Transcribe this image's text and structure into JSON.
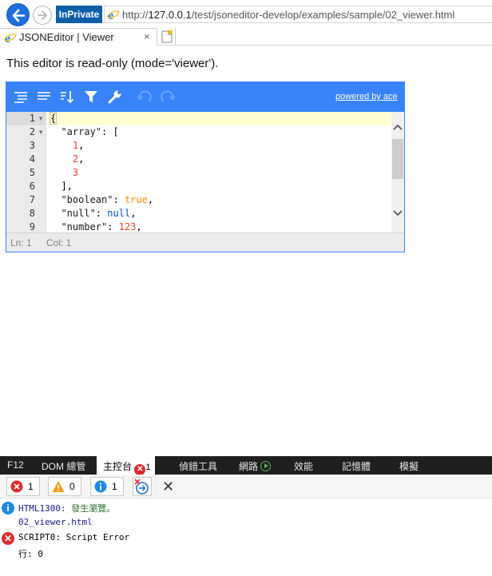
{
  "browser": {
    "inprivate_label": "InPrivate",
    "url_prefix": "http://",
    "url_host": "127.0.0.1",
    "url_path": "/test/jsoneditor-develop/examples/sample/02_viewer.html",
    "tab_title": "JSONEditor | Viewer",
    "tab_close": "×"
  },
  "page": {
    "intro_text": "This editor is read-only (mode='viewer')."
  },
  "editor": {
    "powered_by": "powered by ace",
    "toolbar": [
      "expand-all-icon",
      "collapse-all-icon",
      "sort-icon",
      "filter-icon",
      "transform-icon",
      "undo-icon",
      "redo-icon"
    ],
    "line_numbers": [
      "1",
      "2",
      "3",
      "4",
      "5",
      "6",
      "7",
      "8",
      "9"
    ],
    "lines": [
      "{",
      "  \"array\": [",
      "    1,",
      "    2,",
      "    3",
      "  ],",
      "  \"boolean\": true,",
      "  \"null\": null,",
      "  \"number\": 123,"
    ],
    "status": {
      "ln": "Ln: 1",
      "col": "Col: 1"
    }
  },
  "devtools": {
    "tabs": [
      "F12",
      "DOM 總管",
      "主控台",
      "偵錯工具",
      "網路",
      "效能",
      "記憶體",
      "模擬"
    ],
    "console_error_badge": "1",
    "filters": {
      "errors": "1",
      "warnings": "0",
      "info": "1"
    },
    "messages": [
      {
        "type": "info",
        "code": "HTML1300",
        "text": "發生瀏覽。",
        "line2": "02_viewer.html"
      },
      {
        "type": "error",
        "code": "SCRIPT0",
        "text": "Script Error",
        "line2": "行: 0"
      }
    ],
    "colors": {
      "error": "#e02b2b",
      "warning": "#f39c12",
      "info": "#1e88e5"
    }
  }
}
